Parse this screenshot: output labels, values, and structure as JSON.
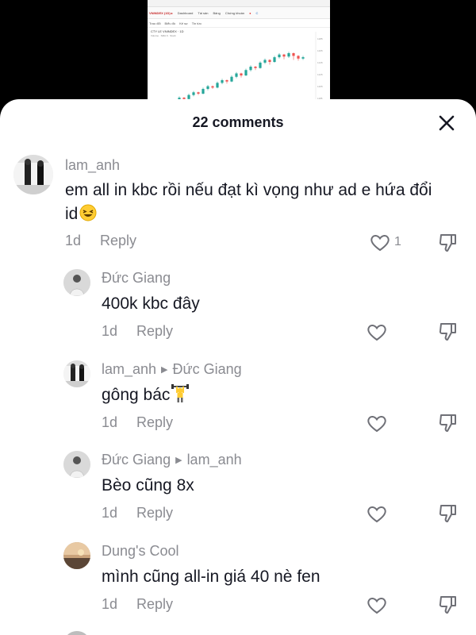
{
  "video": {
    "brand": "VNINDEX (1D) ▸",
    "toolbar_items": [
      "Dashboard",
      "Tài sản",
      "Bảng",
      "Trao đổi",
      "Biểu đồ",
      "Kế sự",
      "Tin tức",
      "Chứng khoán"
    ],
    "symbol": "CTY LE VNINDEX · 1D",
    "sub": "Volume · SMA 9 · Stock"
  },
  "sheet": {
    "title": "22 comments"
  },
  "comments": [
    {
      "user": "lam_anh",
      "reply_to": "",
      "text": "em all in kbc rồi nếu đạt kì vọng như ad e hứa đổi",
      "text_line2": "id",
      "emoji": "laughing-emoji",
      "time": "1d",
      "reply_label": "Reply",
      "likes": "1"
    },
    {
      "user": "Đức Giang",
      "reply_to": "",
      "text": "400k kbc đây",
      "time": "1d",
      "reply_label": "Reply",
      "likes": ""
    },
    {
      "user": "lam_anh",
      "reply_to": "Đức Giang",
      "text": "gông bác",
      "emoji": "weightlifter-emoji",
      "time": "1d",
      "reply_label": "Reply",
      "likes": ""
    },
    {
      "user": "Đức Giang",
      "reply_to": "lam_anh",
      "text": "Bèo cũng 8x",
      "time": "1d",
      "reply_label": "Reply",
      "likes": ""
    },
    {
      "user": "Dung's Cool",
      "reply_to": "",
      "text": "mình cũng all-in giá 40 nè fen",
      "time": "1d",
      "reply_label": "Reply",
      "likes": ""
    }
  ],
  "icons": {
    "close": "close-icon",
    "heart": "heart-outline-icon",
    "dislike": "thumbs-down-icon"
  },
  "colors": {
    "text": "#161823",
    "secondary": "#8a8b91",
    "candle_up": "#26a69a",
    "candle_down": "#ef5350"
  }
}
